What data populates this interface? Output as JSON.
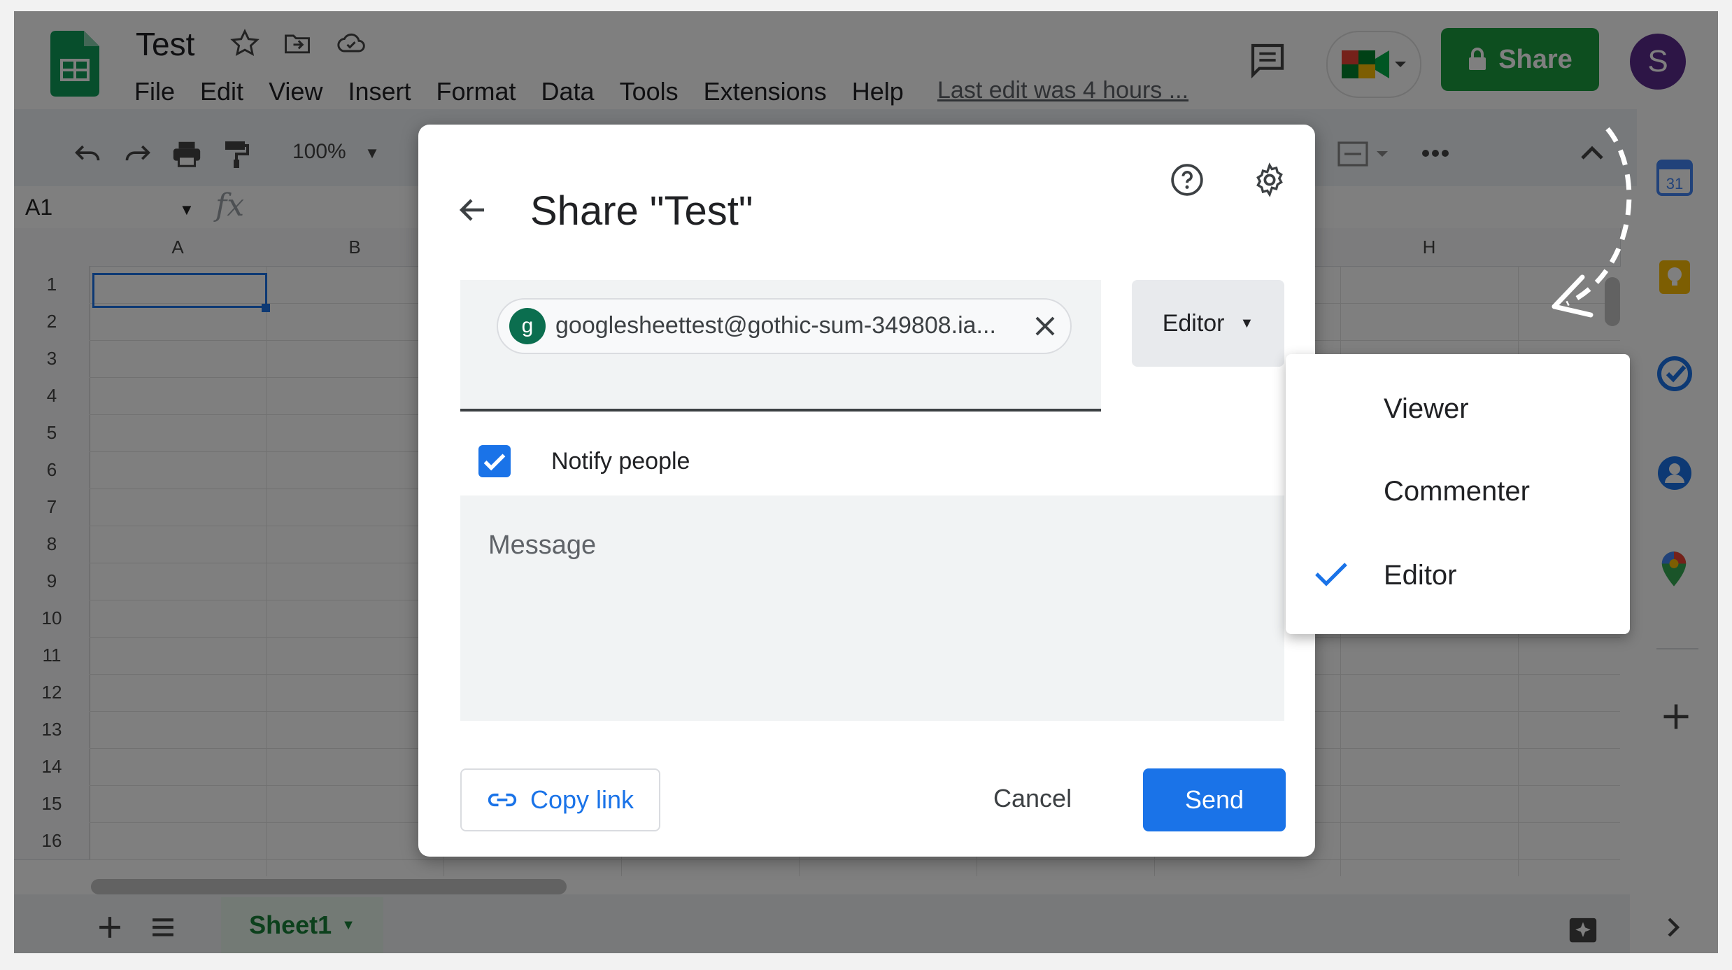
{
  "header": {
    "doc_title": "Test",
    "menu": [
      "File",
      "Edit",
      "View",
      "Insert",
      "Format",
      "Data",
      "Tools",
      "Extensions",
      "Help"
    ],
    "last_edit": "Last edit was 4 hours ...",
    "share_label": "Share",
    "avatar_letter": "S"
  },
  "toolbar": {
    "zoom": "100%",
    "name_box": "A1",
    "fx": "fx"
  },
  "grid": {
    "columns": [
      "A",
      "B",
      "H"
    ],
    "rows": [
      "1",
      "2",
      "3",
      "4",
      "5",
      "6",
      "7",
      "8",
      "9",
      "10",
      "11",
      "12",
      "13",
      "14",
      "15",
      "16"
    ]
  },
  "sheet_tab": "Sheet1",
  "sidepanel": {
    "calendar_day": "31"
  },
  "dialog": {
    "title": "Share \"Test\"",
    "chip_avatar": "g",
    "chip_email": "googlesheettest@gothic-sum-349808.ia...",
    "role": "Editor",
    "notify_label": "Notify people",
    "notify_checked": true,
    "message_placeholder": "Message",
    "copy_link": "Copy link",
    "cancel": "Cancel",
    "send": "Send"
  },
  "role_menu": {
    "items": [
      "Viewer",
      "Commenter",
      "Editor"
    ],
    "selected": "Editor"
  },
  "colors": {
    "share_green": "#1a9c3e",
    "primary_blue": "#1a73e8",
    "avatar_purple": "#5b2b8c"
  }
}
